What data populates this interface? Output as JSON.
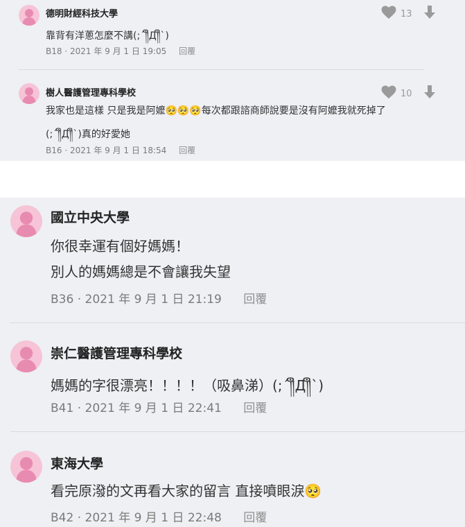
{
  "top_comments": [
    {
      "author": "德明財經科技大學",
      "lines": [
        "靠背有洋蔥怎麼不講(;´༎ຶД༎ຶ`)"
      ],
      "floor": "B18",
      "time": "2021 年 9 月 1 日 19:05",
      "reply_label": "回覆",
      "likes": "13"
    },
    {
      "author": "樹人醫護管理專科學校",
      "lines": [
        "我家也是這樣 只是我是阿嬤🥺🥺🥺每次都跟諮商師說要是沒有阿嬤我就死掉了",
        "(;´༎ຶД༎ຶ`)真的好愛她"
      ],
      "floor": "B16",
      "time": "2021 年 9 月 1 日 18:54",
      "reply_label": "回覆",
      "likes": "10"
    }
  ],
  "bottom_comments": [
    {
      "author": "國立中央大學",
      "lines": [
        "你很幸運有個好媽媽！",
        "別人的媽媽總是不會讓我失望"
      ],
      "floor": "B36",
      "time": "2021 年 9 月 1 日 21:19",
      "reply_label": "回覆"
    },
    {
      "author": "崇仁醫護管理專科學校",
      "lines": [
        "媽媽的字很漂亮！！！！（吸鼻涕）(;´༎ຶД༎ຶ`)"
      ],
      "floor": "B41",
      "time": "2021 年 9 月 1 日 22:41",
      "reply_label": "回覆"
    },
    {
      "author": "東海大學",
      "lines": [
        "看完原潑的文再看大家的留言 直接噴眼淚🥺"
      ],
      "floor": "B42",
      "time": "2021 年 9 月 1 日 22:48",
      "reply_label": "回覆"
    }
  ],
  "colors": {
    "background": "#eef0f3",
    "avatar": "#f6c4d6",
    "avatar_figure": "#e88bb0",
    "vote_icon": "#9a9a9a"
  },
  "icons": [
    "avatar-icon",
    "heart-icon",
    "downvote-arrow-icon"
  ]
}
